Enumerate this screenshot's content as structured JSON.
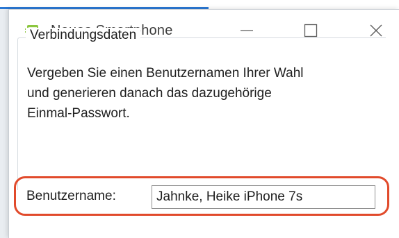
{
  "window": {
    "title": "Neues Smartphone",
    "icon": "smartphone-app-icon",
    "controls": {
      "minimize_icon": "minimize-icon",
      "maximize_icon": "maximize-icon",
      "close_icon": "close-icon"
    }
  },
  "connection_group": {
    "legend": "Verbindungsdaten",
    "description_lines": [
      "Vergeben Sie einen Benutzernamen Ihrer Wahl",
      "und generieren danach das dazugehörige",
      "Einmal-Passwort."
    ],
    "username": {
      "label": "Benutzername:",
      "value": "Jahnke, Heike iPhone 7s"
    }
  },
  "colors": {
    "accent_blue": "#2b78d4",
    "highlight_red": "#e14a2b",
    "icon_green": "#8cc63f"
  }
}
